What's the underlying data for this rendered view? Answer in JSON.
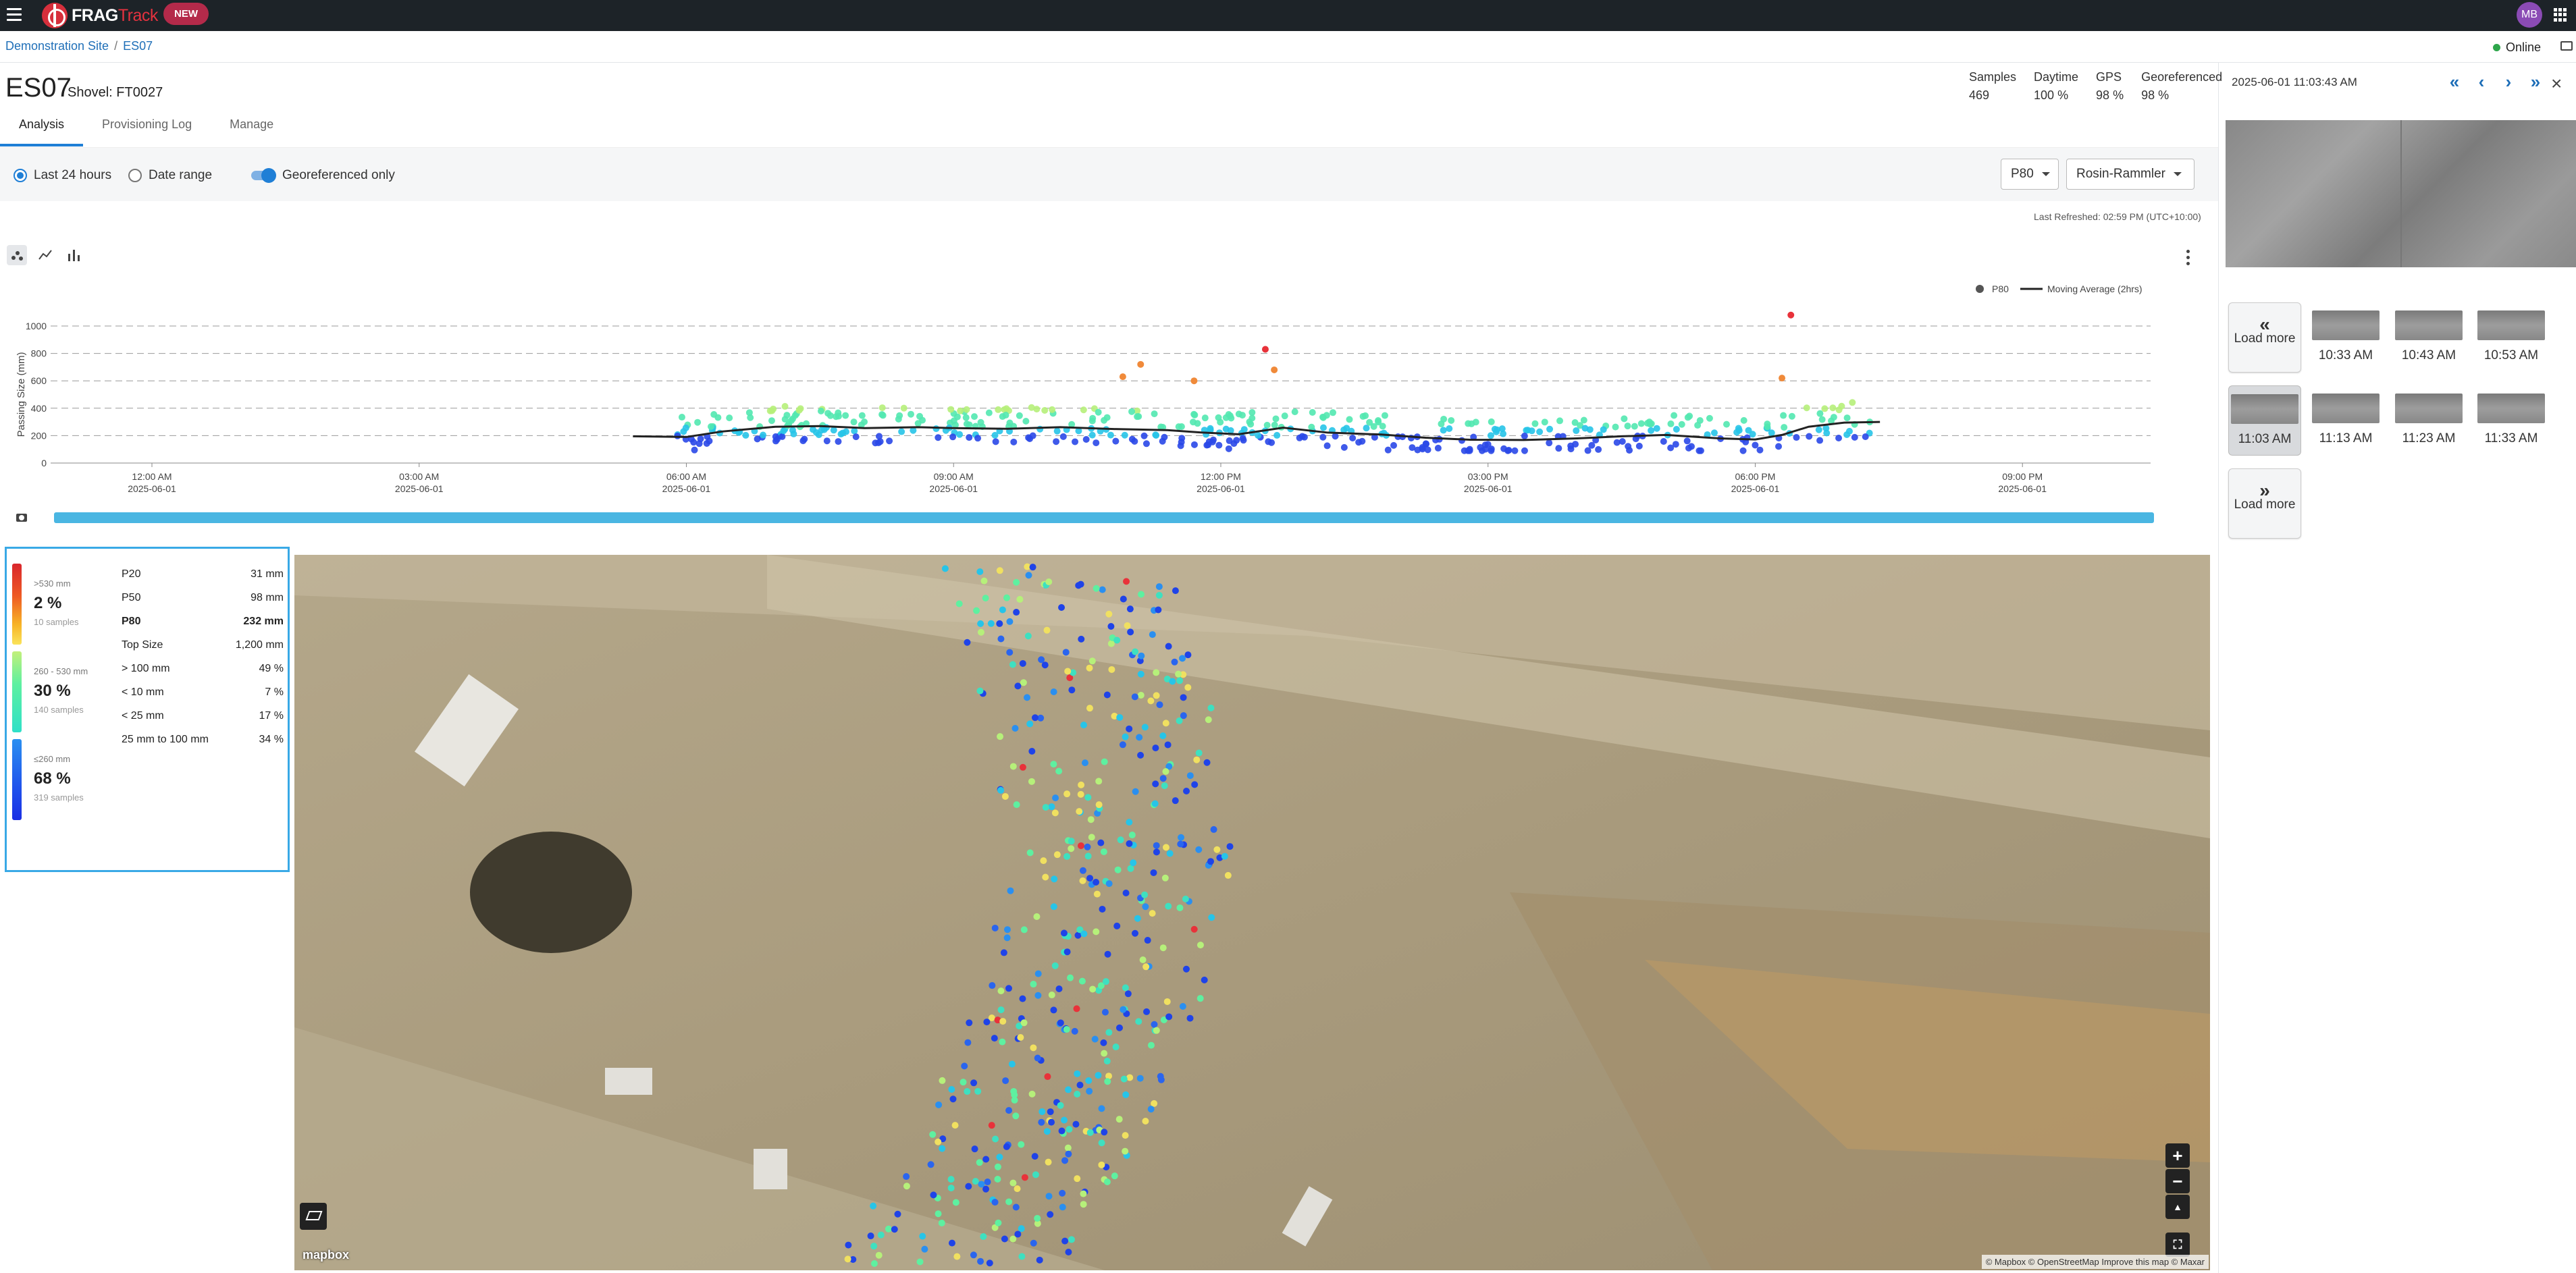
{
  "app": {
    "brand_main": "FRAG",
    "brand_accent": "Track",
    "new_badge": "NEW",
    "user_initials": "MB",
    "status": "Online"
  },
  "breadcrumb": {
    "site": "Demonstration Site",
    "current": "ES07"
  },
  "header": {
    "title": "ES07",
    "subtitle": "Shovel: FT0027"
  },
  "stats": [
    {
      "label": "Samples",
      "value": "469"
    },
    {
      "label": "Daytime",
      "value": "100 %"
    },
    {
      "label": "GPS",
      "value": "98 %"
    },
    {
      "label": "Georeferenced",
      "value": "98 %"
    }
  ],
  "tabs": [
    {
      "label": "Analysis",
      "active": true
    },
    {
      "label": "Provisioning Log",
      "active": false
    },
    {
      "label": "Manage",
      "active": false
    }
  ],
  "filters": {
    "last24": "Last 24 hours",
    "date_range": "Date range",
    "georef_only": "Georeferenced only",
    "metric_select": "P80",
    "model_select": "Rosin-Rammler",
    "last_refreshed": "Last Refreshed: 02:59 PM (UTC+10:00)"
  },
  "chart_data": {
    "type": "scatter",
    "ylabel": "Passing Size (mm)",
    "ylim": [
      0,
      1000
    ],
    "yticks": [
      "0",
      "200",
      "400",
      "600",
      "800",
      "1000"
    ],
    "xticks": [
      {
        "time": "12:00 AM",
        "date": "2025-06-01"
      },
      {
        "time": "03:00 AM",
        "date": "2025-06-01"
      },
      {
        "time": "06:00 AM",
        "date": "2025-06-01"
      },
      {
        "time": "09:00 AM",
        "date": "2025-06-01"
      },
      {
        "time": "12:00 PM",
        "date": "2025-06-01"
      },
      {
        "time": "03:00 PM",
        "date": "2025-06-01"
      },
      {
        "time": "06:00 PM",
        "date": "2025-06-01"
      },
      {
        "time": "09:00 PM",
        "date": "2025-06-01"
      }
    ],
    "legend": {
      "points": "P80",
      "line": "Moving Average (2hrs)",
      "placement": "top-right"
    },
    "grid": true,
    "x_range_hours": [
      0,
      23.5
    ],
    "x_data_range_hours": [
      5.4,
      19.4
    ],
    "moving_average": [
      [
        5.4,
        195
      ],
      [
        6.0,
        190
      ],
      [
        6.4,
        230
      ],
      [
        7.0,
        265
      ],
      [
        7.5,
        270
      ],
      [
        8.0,
        255
      ],
      [
        8.6,
        262
      ],
      [
        9.0,
        255
      ],
      [
        9.6,
        250
      ],
      [
        10.2,
        262
      ],
      [
        10.8,
        248
      ],
      [
        11.4,
        240
      ],
      [
        11.8,
        222
      ],
      [
        12.2,
        210
      ],
      [
        12.7,
        258
      ],
      [
        13.2,
        222
      ],
      [
        13.8,
        208
      ],
      [
        14.3,
        185
      ],
      [
        14.8,
        170
      ],
      [
        15.4,
        168
      ],
      [
        16.0,
        180
      ],
      [
        16.5,
        195
      ],
      [
        17.0,
        205
      ],
      [
        17.6,
        180
      ],
      [
        18.0,
        172
      ],
      [
        18.3,
        205
      ],
      [
        18.6,
        265
      ],
      [
        19.0,
        295
      ],
      [
        19.4,
        300
      ]
    ],
    "outliers": [
      {
        "x": 18.4,
        "y": 1080
      },
      {
        "x": 12.5,
        "y": 830
      },
      {
        "x": 11.1,
        "y": 720
      },
      {
        "x": 12.6,
        "y": 680
      },
      {
        "x": 10.9,
        "y": 630
      },
      {
        "x": 11.7,
        "y": 600
      },
      {
        "x": 18.3,
        "y": 620
      }
    ]
  },
  "summary": {
    "bands": [
      {
        "range": ">530 mm",
        "pct": "2 %",
        "count": "10 samples",
        "color": "#e8323a"
      },
      {
        "range": "260 - 530 mm",
        "pct": "30 %",
        "count": "140 samples",
        "color": "#3ee0c0"
      },
      {
        "range": "≤260 mm",
        "pct": "68 %",
        "count": "319 samples",
        "color": "#1f43e8"
      }
    ],
    "metrics": [
      {
        "label": "P20",
        "value": "31 mm",
        "bold": false
      },
      {
        "label": "P50",
        "value": "98 mm",
        "bold": false
      },
      {
        "label": "P80",
        "value": "232 mm",
        "bold": true
      },
      {
        "label": "Top Size",
        "value": "1,200 mm",
        "bold": false
      },
      {
        "label": "> 100 mm",
        "value": "49 %",
        "bold": false
      },
      {
        "label": "< 10 mm",
        "value": "7 %",
        "bold": false
      },
      {
        "label": "< 25 mm",
        "value": "17 %",
        "bold": false
      },
      {
        "label": "25 mm to 100 mm",
        "value": "34 %",
        "bold": false
      }
    ]
  },
  "map": {
    "attribution": "© Mapbox © OpenStreetMap Improve this map © Maxar",
    "logo": "mapbox"
  },
  "right_panel": {
    "timestamp": "2025-06-01 11:03:43 AM",
    "load_more": "Load more",
    "thumbnails": [
      "10:33 AM",
      "10:43 AM",
      "10:53 AM",
      "11:03 AM",
      "11:13 AM",
      "11:23 AM",
      "11:33 AM"
    ],
    "selected": "11:03 AM"
  }
}
